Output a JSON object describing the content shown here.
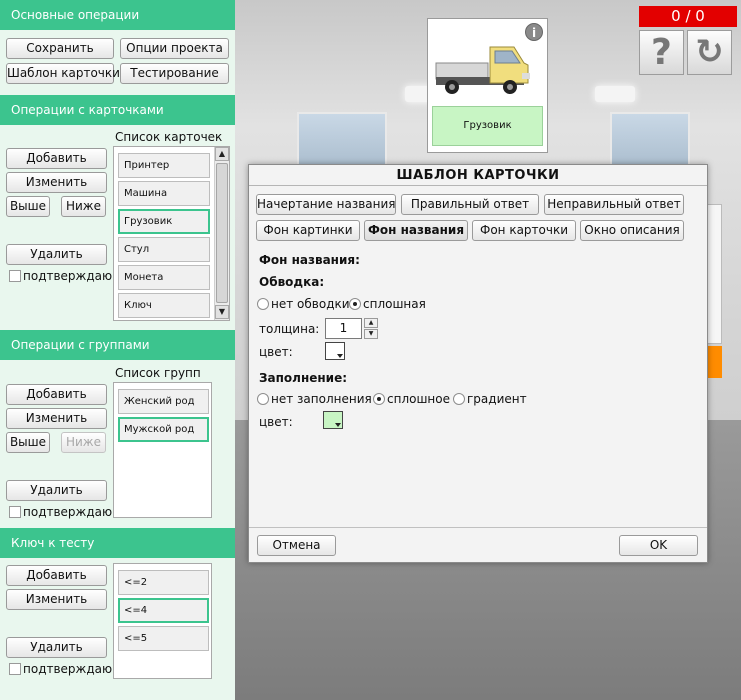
{
  "basic_ops": {
    "title": "Основные операции",
    "save": "Сохранить",
    "project_options": "Опции проекта",
    "card_template": "Шаблон карточки",
    "testing": "Тестирование"
  },
  "card_ops": {
    "title": "Операции с карточками",
    "list_title": "Список карточек",
    "add": "Добавить",
    "edit": "Изменить",
    "up": "Выше",
    "down": "Ниже",
    "delete": "Удалить",
    "confirm": "подтверждаю",
    "items": [
      "Принтер",
      "Машина",
      "Грузовик",
      "Стул",
      "Монета",
      "Ключ"
    ]
  },
  "group_ops": {
    "title": "Операции с группами",
    "list_title": "Список групп",
    "add": "Добавить",
    "edit": "Изменить",
    "up": "Выше",
    "down": "Ниже",
    "delete": "Удалить",
    "confirm": "подтверждаю",
    "items": [
      "Женский род",
      "Мужской род"
    ]
  },
  "test_key": {
    "title": "Ключ к тесту",
    "add": "Добавить",
    "edit": "Изменить",
    "delete": "Удалить",
    "confirm": "подтверждаю",
    "items": [
      "<=2",
      "<=4",
      "<=5"
    ]
  },
  "scene": {
    "card_label": "Грузовик",
    "info_icon": "i",
    "score": "0 / 0",
    "help_icon": "?",
    "restart_icon": "↻"
  },
  "dialog": {
    "title": "ШАБЛОН КАРТОЧКИ",
    "tabs": [
      "Начертание названия",
      "Правильный ответ",
      "Неправильный ответ",
      "Фон картинки",
      "Фон названия",
      "Фон карточки",
      "Окно описания"
    ],
    "section_title": "Фон названия:",
    "outline": {
      "title": "Обводка:",
      "none": "нет обводки",
      "solid": "сплошная",
      "thickness_label": "толщина:",
      "thickness_value": "1",
      "color_label": "цвет:",
      "color": "#ffffff"
    },
    "fill": {
      "title": "Заполнение:",
      "none": "нет заполнения",
      "solid": "сплошное",
      "gradient": "градиент",
      "color_label": "цвет:",
      "color": "#c8f5c4"
    },
    "cancel": "Отмена",
    "ok": "OK"
  },
  "colors": {
    "accent": "#3cc48e",
    "score_bg": "#e30000",
    "orange": "#ff8c00"
  }
}
